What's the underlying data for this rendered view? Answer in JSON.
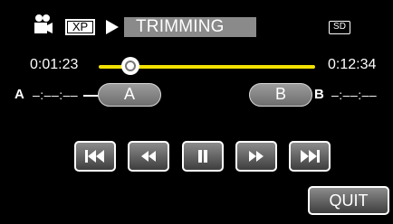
{
  "header": {
    "camera_icon": "video-camera-icon",
    "quality_badge": "XP",
    "playback_icon": "play-icon",
    "mode_title": "TRIMMING",
    "media_badge": "SD"
  },
  "timeline": {
    "current_time": "0:01:23",
    "total_time": "0:12:34",
    "progress_fraction": 0.11,
    "track_color": "#f2e100"
  },
  "trim": {
    "a_label": "A",
    "a_time": "–:––:––",
    "a_button": "A",
    "b_button": "B",
    "b_label": "B",
    "b_time": "–:––:––"
  },
  "controls": {
    "skip_back": "skip-to-start-icon",
    "rewind": "rewind-icon",
    "pause": "pause-icon",
    "fast_forward": "fast-forward-icon",
    "skip_forward": "skip-to-end-icon"
  },
  "quit_label": "QUIT"
}
